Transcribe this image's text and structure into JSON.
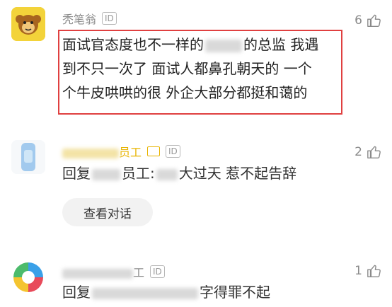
{
  "comments": [
    {
      "username": "秃笔翁",
      "id_badge": "ID",
      "lines": [
        "面试官态度也不一样的",
        "的总监 我遇",
        "到不只一次了 面试人都鼻孔朝天的 一个",
        "个牛皮哄哄的很 外企大部分都挺和蔼的"
      ],
      "likes": "6"
    },
    {
      "username_suffix": "员工",
      "id_badge": "ID",
      "reply_prefix": "回复",
      "reply_name_suffix": "员工:",
      "text": "大过天 惹不起告辞",
      "likes": "2",
      "view_conversation": "查看对话"
    },
    {
      "username_suffix": "工",
      "id_badge": "ID",
      "reply_prefix": "回复",
      "text": "字得罪不起",
      "likes": "1"
    }
  ],
  "icons": {
    "thumb": "thumbs-up-icon",
    "avatar1": "monkey-avatar-icon",
    "avatar2": "bottle-avatar-icon",
    "avatar3": "colorful-logo-avatar-icon"
  },
  "colors": {
    "highlight": "#e04040",
    "muted": "#8a8a8a",
    "accent": "#f2c200"
  }
}
